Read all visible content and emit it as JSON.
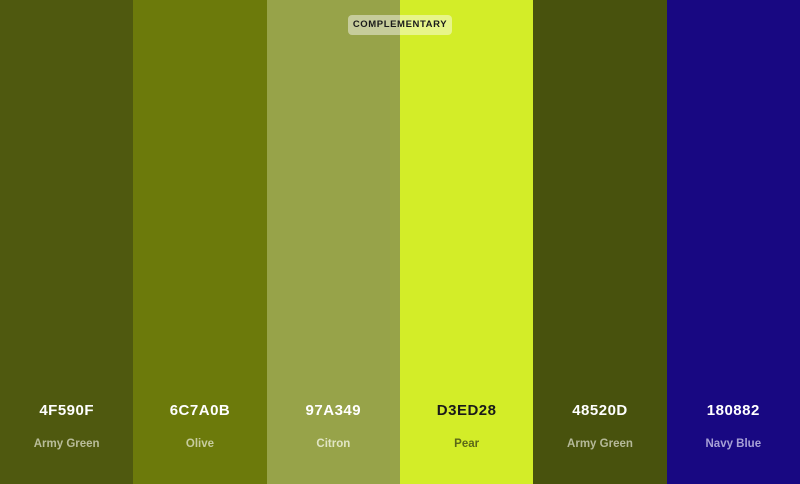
{
  "badge": {
    "label": "COMPLEMENTARY"
  },
  "swatches": [
    {
      "hex": "4F590F",
      "name": "Army Green",
      "color": "#4F590F",
      "text_color": "#FFFFFF",
      "name_color": "#B9BD9A"
    },
    {
      "hex": "6C7A0B",
      "name": "Olive",
      "color": "#6C7A0B",
      "text_color": "#FFFFFF",
      "name_color": "#C7CC9E"
    },
    {
      "hex": "97A349",
      "name": "Citron",
      "color": "#97A349",
      "text_color": "#FFFFFF",
      "name_color": "#E1E5C4"
    },
    {
      "hex": "D3ED28",
      "name": "Pear",
      "color": "#D3ED28",
      "text_color": "#1A1A1A",
      "name_color": "#5C6818"
    },
    {
      "hex": "48520D",
      "name": "Army Green",
      "color": "#48520D",
      "text_color": "#FFFFFF",
      "name_color": "#B5B999"
    },
    {
      "hex": "180882",
      "name": "Navy Blue",
      "color": "#180882",
      "text_color": "#FFFFFF",
      "name_color": "#A7A0D6"
    }
  ]
}
